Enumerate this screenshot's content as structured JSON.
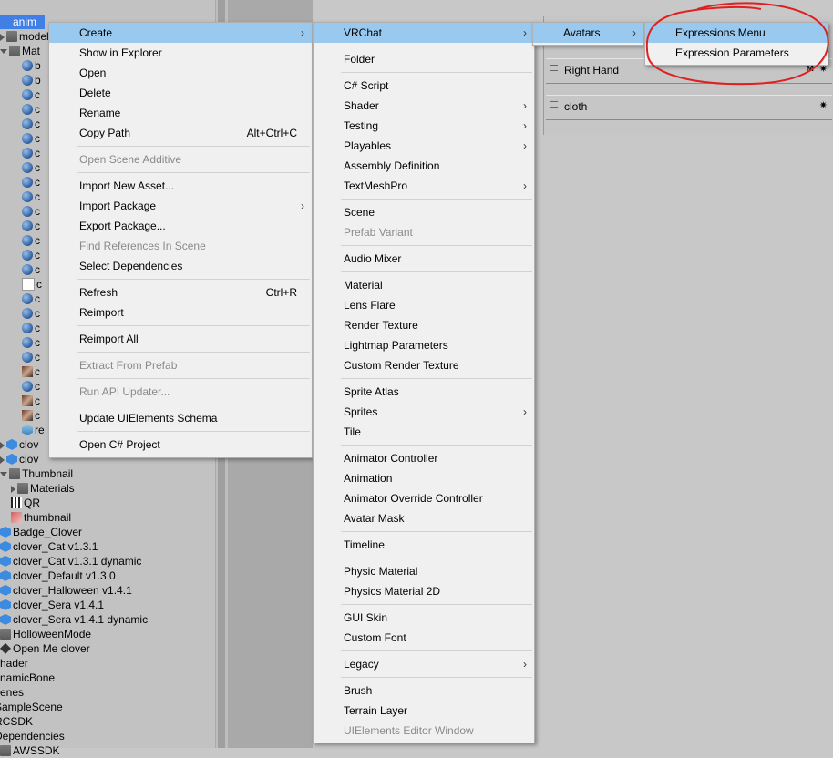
{
  "project_tree": [
    {
      "indent": 0,
      "icon": "none",
      "label": "anim",
      "arrow": "none",
      "selected": true
    },
    {
      "indent": 0,
      "icon": "folder",
      "label": "model",
      "arrow": "right"
    },
    {
      "indent": 0,
      "icon": "folder",
      "label": "Mat",
      "arrow": "down"
    },
    {
      "indent": 2,
      "icon": "sphere",
      "label": "b"
    },
    {
      "indent": 2,
      "icon": "sphere",
      "label": "b"
    },
    {
      "indent": 2,
      "icon": "sphere",
      "label": "c"
    },
    {
      "indent": 2,
      "icon": "sphere",
      "label": "c"
    },
    {
      "indent": 2,
      "icon": "sphere",
      "label": "c"
    },
    {
      "indent": 2,
      "icon": "sphere",
      "label": "c"
    },
    {
      "indent": 2,
      "icon": "sphere",
      "label": "c"
    },
    {
      "indent": 2,
      "icon": "sphere",
      "label": "c"
    },
    {
      "indent": 2,
      "icon": "sphere",
      "label": "c"
    },
    {
      "indent": 2,
      "icon": "sphere",
      "label": "c"
    },
    {
      "indent": 2,
      "icon": "sphere",
      "label": "c"
    },
    {
      "indent": 2,
      "icon": "sphere",
      "label": "c"
    },
    {
      "indent": 2,
      "icon": "sphere",
      "label": "c"
    },
    {
      "indent": 2,
      "icon": "sphere",
      "label": "c"
    },
    {
      "indent": 2,
      "icon": "sphere",
      "label": "c"
    },
    {
      "indent": 2,
      "icon": "white",
      "label": "c"
    },
    {
      "indent": 2,
      "icon": "sphere",
      "label": "c"
    },
    {
      "indent": 2,
      "icon": "sphere",
      "label": "c"
    },
    {
      "indent": 2,
      "icon": "sphere",
      "label": "c"
    },
    {
      "indent": 2,
      "icon": "sphere",
      "label": "c"
    },
    {
      "indent": 2,
      "icon": "sphere",
      "label": "c"
    },
    {
      "indent": 2,
      "icon": "tex",
      "label": "c"
    },
    {
      "indent": 2,
      "icon": "sphere",
      "label": "c"
    },
    {
      "indent": 2,
      "icon": "tex",
      "label": "c"
    },
    {
      "indent": 2,
      "icon": "tex",
      "label": "c"
    },
    {
      "indent": 2,
      "icon": "ctrl",
      "label": "re"
    },
    {
      "indent": 0,
      "icon": "cube",
      "label": "clov",
      "arrow": "right"
    },
    {
      "indent": 0,
      "icon": "cube",
      "label": "clov",
      "arrow": "right"
    },
    {
      "indent": 0,
      "icon": "folder",
      "label": "Thumbnail",
      "arrow": "down"
    },
    {
      "indent": 1,
      "icon": "folder",
      "label": "Materials",
      "arrow": "right"
    },
    {
      "indent": 1,
      "icon": "qr",
      "label": "QR"
    },
    {
      "indent": 1,
      "icon": "img",
      "label": "thumbnail"
    },
    {
      "indent": 0,
      "icon": "cube",
      "label": "Badge_Clover"
    },
    {
      "indent": 0,
      "icon": "cube",
      "label": "clover_Cat v1.3.1"
    },
    {
      "indent": 0,
      "icon": "cube",
      "label": "clover_Cat v1.3.1 dynamic"
    },
    {
      "indent": 0,
      "icon": "cube",
      "label": "clover_Default v1.3.0"
    },
    {
      "indent": 0,
      "icon": "cube",
      "label": "clover_Halloween v1.4.1"
    },
    {
      "indent": 0,
      "icon": "cube",
      "label": "clover_Sera v1.4.1"
    },
    {
      "indent": 0,
      "icon": "cube",
      "label": "clover_Sera v1.4.1 dynamic"
    },
    {
      "indent": 0,
      "icon": "folder",
      "label": "HolloweenMode"
    },
    {
      "indent": 0,
      "icon": "unity",
      "label": "Open Me clover"
    },
    {
      "indent": -1,
      "icon": "none",
      "label": "shader"
    },
    {
      "indent": -1,
      "icon": "none",
      "label": "ynamicBone"
    },
    {
      "indent": -1,
      "icon": "none",
      "label": "cenes"
    },
    {
      "indent": -1,
      "icon": "none",
      "label": "SampleScene"
    },
    {
      "indent": -1,
      "icon": "none",
      "label": "RCSDK"
    },
    {
      "indent": -1,
      "icon": "none",
      "label": "Dependencies"
    },
    {
      "indent": 0,
      "icon": "folder",
      "label": "AWSSDK"
    }
  ],
  "inspector": {
    "rows": [
      {
        "label": "Right Hand",
        "badge": "M",
        "gear": "✷"
      },
      {
        "label": "cloth",
        "badge": "",
        "gear": "✷"
      }
    ]
  },
  "context_menu": [
    {
      "type": "item",
      "label": "Create",
      "submenu": true,
      "hl": true
    },
    {
      "type": "item",
      "label": "Show in Explorer"
    },
    {
      "type": "item",
      "label": "Open"
    },
    {
      "type": "item",
      "label": "Delete"
    },
    {
      "type": "item",
      "label": "Rename"
    },
    {
      "type": "item",
      "label": "Copy Path",
      "shortcut": "Alt+Ctrl+C"
    },
    {
      "type": "sep"
    },
    {
      "type": "item",
      "label": "Open Scene Additive",
      "disabled": true
    },
    {
      "type": "sep"
    },
    {
      "type": "item",
      "label": "Import New Asset..."
    },
    {
      "type": "item",
      "label": "Import Package",
      "submenu": true
    },
    {
      "type": "item",
      "label": "Export Package..."
    },
    {
      "type": "item",
      "label": "Find References In Scene",
      "disabled": true
    },
    {
      "type": "item",
      "label": "Select Dependencies"
    },
    {
      "type": "sep"
    },
    {
      "type": "item",
      "label": "Refresh",
      "shortcut": "Ctrl+R"
    },
    {
      "type": "item",
      "label": "Reimport"
    },
    {
      "type": "sep"
    },
    {
      "type": "item",
      "label": "Reimport All"
    },
    {
      "type": "sep"
    },
    {
      "type": "item",
      "label": "Extract From Prefab",
      "disabled": true
    },
    {
      "type": "sep"
    },
    {
      "type": "item",
      "label": "Run API Updater...",
      "disabled": true
    },
    {
      "type": "sep"
    },
    {
      "type": "item",
      "label": "Update UIElements Schema"
    },
    {
      "type": "sep"
    },
    {
      "type": "item",
      "label": "Open C# Project"
    }
  ],
  "create_menu": [
    {
      "type": "item",
      "label": "VRChat",
      "submenu": true,
      "hl": true
    },
    {
      "type": "sep"
    },
    {
      "type": "item",
      "label": "Folder"
    },
    {
      "type": "sep"
    },
    {
      "type": "item",
      "label": "C# Script"
    },
    {
      "type": "item",
      "label": "Shader",
      "submenu": true
    },
    {
      "type": "item",
      "label": "Testing",
      "submenu": true
    },
    {
      "type": "item",
      "label": "Playables",
      "submenu": true
    },
    {
      "type": "item",
      "label": "Assembly Definition"
    },
    {
      "type": "item",
      "label": "TextMeshPro",
      "submenu": true
    },
    {
      "type": "sep"
    },
    {
      "type": "item",
      "label": "Scene"
    },
    {
      "type": "item",
      "label": "Prefab Variant",
      "disabled": true
    },
    {
      "type": "sep"
    },
    {
      "type": "item",
      "label": "Audio Mixer"
    },
    {
      "type": "sep"
    },
    {
      "type": "item",
      "label": "Material"
    },
    {
      "type": "item",
      "label": "Lens Flare"
    },
    {
      "type": "item",
      "label": "Render Texture"
    },
    {
      "type": "item",
      "label": "Lightmap Parameters"
    },
    {
      "type": "item",
      "label": "Custom Render Texture"
    },
    {
      "type": "sep"
    },
    {
      "type": "item",
      "label": "Sprite Atlas"
    },
    {
      "type": "item",
      "label": "Sprites",
      "submenu": true
    },
    {
      "type": "item",
      "label": "Tile"
    },
    {
      "type": "sep"
    },
    {
      "type": "item",
      "label": "Animator Controller"
    },
    {
      "type": "item",
      "label": "Animation"
    },
    {
      "type": "item",
      "label": "Animator Override Controller"
    },
    {
      "type": "item",
      "label": "Avatar Mask"
    },
    {
      "type": "sep"
    },
    {
      "type": "item",
      "label": "Timeline"
    },
    {
      "type": "sep"
    },
    {
      "type": "item",
      "label": "Physic Material"
    },
    {
      "type": "item",
      "label": "Physics Material 2D"
    },
    {
      "type": "sep"
    },
    {
      "type": "item",
      "label": "GUI Skin"
    },
    {
      "type": "item",
      "label": "Custom Font"
    },
    {
      "type": "sep"
    },
    {
      "type": "item",
      "label": "Legacy",
      "submenu": true
    },
    {
      "type": "sep"
    },
    {
      "type": "item",
      "label": "Brush"
    },
    {
      "type": "item",
      "label": "Terrain Layer"
    },
    {
      "type": "item",
      "label": "UIElements Editor Window",
      "disabled": true
    }
  ],
  "vrchat_menu": [
    {
      "type": "item",
      "label": "Avatars",
      "submenu": true,
      "hl": true
    }
  ],
  "avatars_menu": [
    {
      "type": "item",
      "label": "Expressions Menu",
      "hl": true
    },
    {
      "type": "item",
      "label": "Expression Parameters"
    }
  ],
  "submenu_glyph": "›",
  "colors": {
    "highlight": "#99c9ef",
    "selection": "#3f7fe6",
    "annotation": "#e02020"
  }
}
